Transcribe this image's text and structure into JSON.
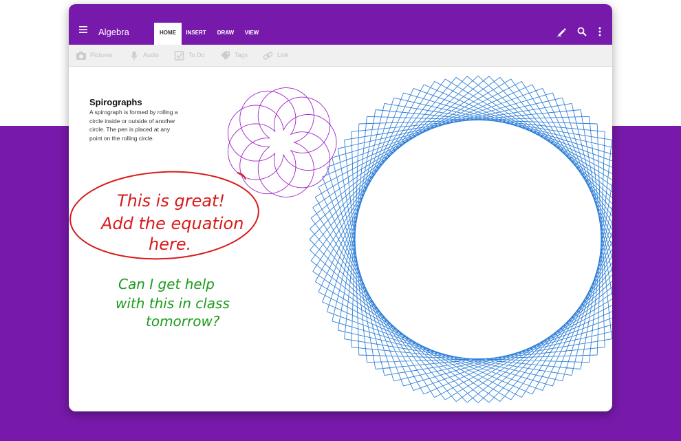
{
  "app": {
    "title": "Algebra"
  },
  "tabs": [
    {
      "label": "HOME",
      "active": true
    },
    {
      "label": "INSERT",
      "active": false
    },
    {
      "label": "DRAW",
      "active": false
    },
    {
      "label": "VIEW",
      "active": false
    }
  ],
  "toolbar_icons": [
    "pen-icon",
    "search-icon",
    "more-vert-icon"
  ],
  "ribbon": [
    {
      "label": "Pictures",
      "icon": "camera-icon"
    },
    {
      "label": "Audio",
      "icon": "mic-icon"
    },
    {
      "label": "To Do",
      "icon": "checkbox-icon"
    },
    {
      "label": "Tags",
      "icon": "tag-icon"
    },
    {
      "label": "Link",
      "icon": "link-icon"
    }
  ],
  "note": {
    "title": "Spirographs",
    "body": "A spirograph is formed by rolling a circle inside or outside of another circle. The pen is placed at any point on the rolling circle."
  },
  "ink": {
    "red_line1": "This is great!",
    "red_line2": "Add the equation",
    "red_line3": "here.",
    "green_line1": "Can I get help",
    "green_line2": "with this in class",
    "green_line3": "tomorrow?"
  },
  "colors": {
    "brand_purple": "#7719aa",
    "ribbon_bg": "#f0f0f0",
    "ink_red": "#d81b1b",
    "ink_green": "#1a9b1a",
    "spiro_purple": "#a020c8",
    "spiro_blue": "#2f7fd8"
  }
}
